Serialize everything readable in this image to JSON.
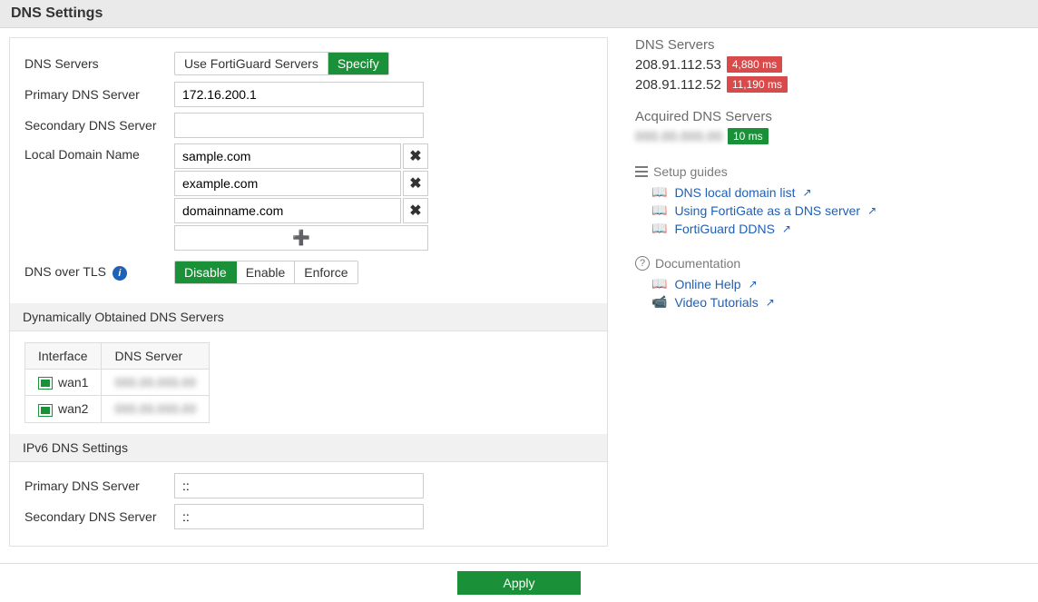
{
  "header": {
    "title": "DNS Settings"
  },
  "form": {
    "dns_servers_label": "DNS Servers",
    "seg_fortiguard": "Use FortiGuard Servers",
    "seg_specify": "Specify",
    "primary_label": "Primary DNS Server",
    "primary_value": "172.16.200.1",
    "secondary_label": "Secondary DNS Server",
    "secondary_value": "",
    "local_domain_label": "Local Domain Name",
    "domains": [
      "sample.com",
      "example.com",
      "domainname.com"
    ],
    "dns_tls_label": "DNS over TLS",
    "tls_disable": "Disable",
    "tls_enable": "Enable",
    "tls_enforce": "Enforce"
  },
  "dyn": {
    "title": "Dynamically Obtained DNS Servers",
    "col_interface": "Interface",
    "col_server": "DNS Server",
    "rows": [
      {
        "iface": "wan1",
        "server": "000.00.000.00"
      },
      {
        "iface": "wan2",
        "server": "000.00.000.00"
      }
    ]
  },
  "ipv6": {
    "title": "IPv6 DNS Settings",
    "primary_label": "Primary DNS Server",
    "primary_value": "::",
    "secondary_label": "Secondary DNS Server",
    "secondary_value": "::"
  },
  "side": {
    "servers_title": "DNS Servers",
    "servers": [
      {
        "ip": "208.91.112.53",
        "latency": "4,880 ms",
        "cls": "red"
      },
      {
        "ip": "208.91.112.52",
        "latency": "11,190 ms",
        "cls": "red"
      }
    ],
    "acquired_title": "Acquired DNS Servers",
    "acquired": [
      {
        "ip": "000.00.000.00",
        "latency": "10 ms",
        "cls": "green",
        "blur": true
      }
    ],
    "setup_title": "Setup guides",
    "setup_links": [
      "DNS local domain list",
      "Using FortiGate as a DNS server",
      "FortiGuard DDNS"
    ],
    "doc_title": "Documentation",
    "doc_links": [
      {
        "label": "Online Help",
        "icon": "book"
      },
      {
        "label": "Video Tutorials",
        "icon": "cam"
      }
    ]
  },
  "footer": {
    "apply": "Apply"
  }
}
